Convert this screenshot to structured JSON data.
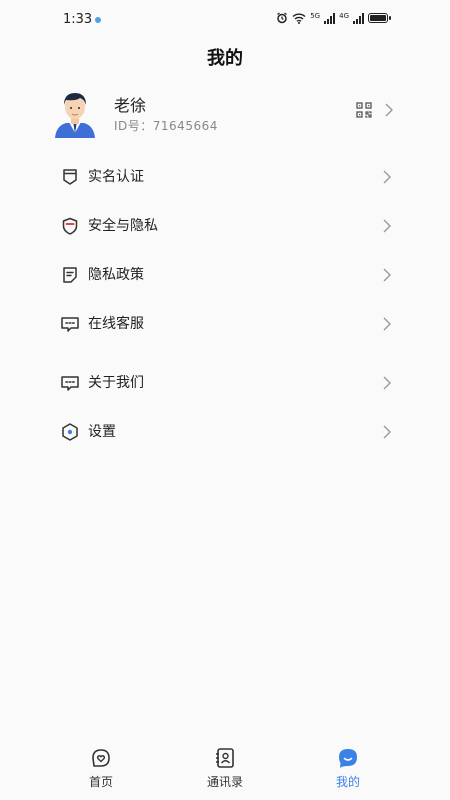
{
  "status": {
    "time": "1:33",
    "net1": "5G",
    "net2": "4G"
  },
  "header": {
    "title": "我的"
  },
  "profile": {
    "name": "老徐",
    "id_label": "ID号：71645664"
  },
  "menu": [
    {
      "key": "realname",
      "label": "实名认证",
      "icon": "id-badge-icon"
    },
    {
      "key": "security",
      "label": "安全与隐私",
      "icon": "shield-icon"
    },
    {
      "key": "policy",
      "label": "隐私政策",
      "icon": "document-icon"
    },
    {
      "key": "service",
      "label": "在线客服",
      "icon": "chat-icon"
    },
    {
      "key": "about",
      "label": "关于我们",
      "icon": "chat-icon"
    },
    {
      "key": "settings",
      "label": "设置",
      "icon": "settings-hexagon-icon"
    }
  ],
  "tabbar": {
    "tabs": [
      {
        "label": "首页",
        "icon": "home-icon"
      },
      {
        "label": "通讯录",
        "icon": "contacts-icon"
      },
      {
        "label": "我的",
        "icon": "profile-icon",
        "active": true
      }
    ]
  },
  "colors": {
    "accent": "#3b82e6",
    "shield_accent": "#e2474b",
    "background": "#fafafa"
  }
}
